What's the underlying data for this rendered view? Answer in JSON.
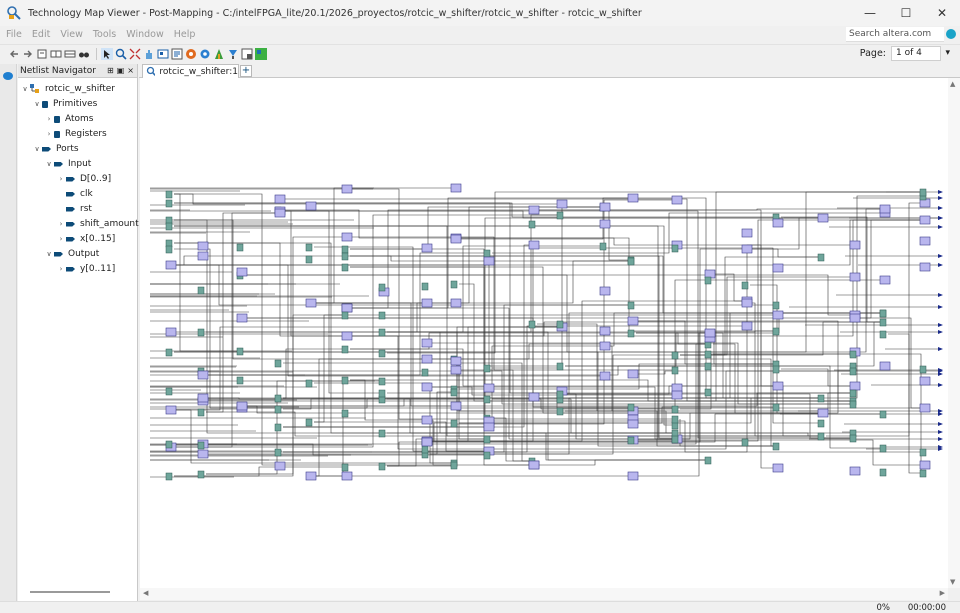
{
  "window": {
    "title": "Technology Map Viewer - Post-Mapping - C:/intelFPGA_lite/20.1/2026_proyectos/rotcic_w_shifter/rotcic_w_shifter - rotcic_w_shifter",
    "controls": [
      "—",
      "☐",
      "✕"
    ]
  },
  "menu": [
    "File",
    "Edit",
    "View",
    "Tools",
    "Window",
    "Help"
  ],
  "search": {
    "placeholder": "Search altera.com"
  },
  "toolbar": {
    "icons": [
      "back-icon",
      "forward-icon",
      "netlist-icon",
      "expand-icon",
      "collapse-icon",
      "binoculars-icon",
      "select-icon",
      "zoom-icon",
      "fit-icon",
      "pan-icon",
      "view-icon",
      "hierarchy-icon",
      "color-icon",
      "settings-icon",
      "paint-icon",
      "find-icon",
      "layout-icon",
      "green-icon"
    ],
    "page_label": "Page:",
    "page_value": "1 of 4"
  },
  "navigator": {
    "title": "Netlist Navigator",
    "tree": [
      {
        "label": "rotcic_w_shifter",
        "level": 0,
        "arrow": "down",
        "icon": "top"
      },
      {
        "label": "Primitives",
        "level": 1,
        "arrow": "down",
        "icon": "db"
      },
      {
        "label": "Atoms",
        "level": 2,
        "arrow": "right",
        "icon": "db"
      },
      {
        "label": "Registers",
        "level": 2,
        "arrow": "right",
        "icon": "db"
      },
      {
        "label": "Ports",
        "level": 1,
        "arrow": "down",
        "icon": "port"
      },
      {
        "label": "Input",
        "level": 2,
        "arrow": "down",
        "icon": "port"
      },
      {
        "label": "D[0..9]",
        "level": 3,
        "arrow": "right",
        "icon": "port"
      },
      {
        "label": "clk",
        "level": 3,
        "arrow": "",
        "icon": "port"
      },
      {
        "label": "rst",
        "level": 3,
        "arrow": "",
        "icon": "port"
      },
      {
        "label": "shift_amount",
        "level": 3,
        "arrow": "right",
        "icon": "port"
      },
      {
        "label": "x[0..15]",
        "level": 3,
        "arrow": "right",
        "icon": "port"
      },
      {
        "label": "Output",
        "level": 2,
        "arrow": "down",
        "icon": "port"
      },
      {
        "label": "y[0..11]",
        "level": 3,
        "arrow": "right",
        "icon": "port"
      }
    ]
  },
  "tab": {
    "label": "rotcic_w_shifter:1",
    "add": "+"
  },
  "colors": {
    "block_fill": "#b9b6ee",
    "block_stroke": "#3c3c8c",
    "cell_fill": "#6fa59b",
    "cell_stroke": "#2f5a52",
    "wire": "#3a3a3a"
  },
  "status": {
    "progress": "0%",
    "time": "00:00:00"
  }
}
